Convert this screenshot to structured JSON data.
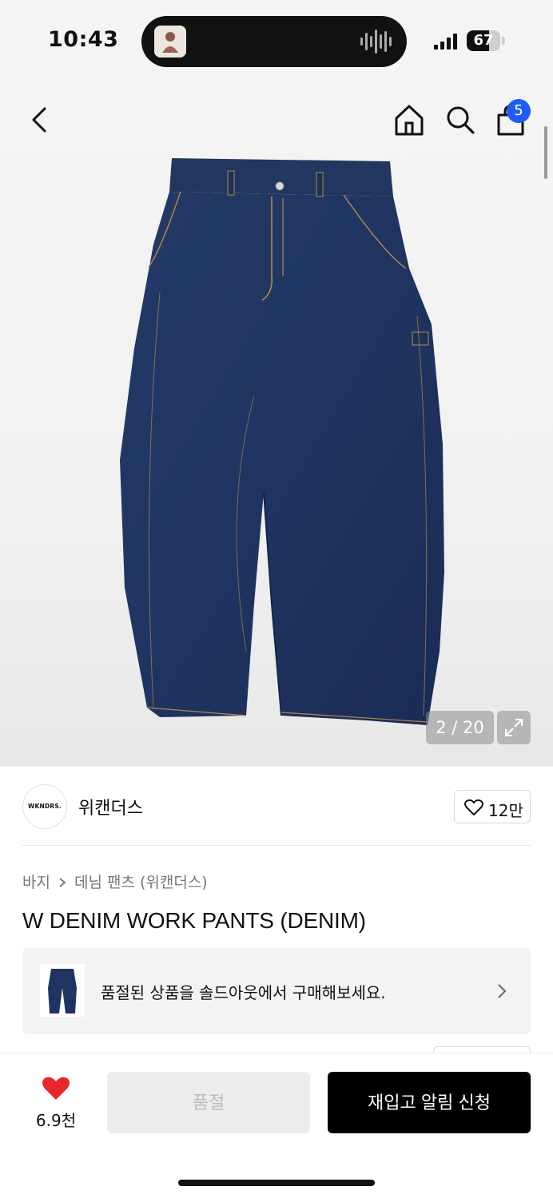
{
  "status_bar": {
    "time": "10:43",
    "battery_level": 67,
    "battery_text": "67"
  },
  "nav": {
    "back_icon": "chevron-left-icon",
    "home_icon": "home-icon",
    "search_icon": "search-icon",
    "cart_icon": "shopping-bag-icon",
    "cart_badge": "5",
    "badge_color": "#1f5cf5"
  },
  "gallery": {
    "counter": "2 / 20",
    "expand_icon": "expand-icon"
  },
  "brand": {
    "logo_text": "WKNDRS.",
    "name": "위캔더스",
    "likes": "12만"
  },
  "breadcrumb": {
    "category": "바지",
    "subcategory": "데님 팬츠 (위캔더스)"
  },
  "product": {
    "title": "W DENIM WORK PANTS (DENIM)"
  },
  "soldout_banner": {
    "text": "품절된 상품을 솔드아웃에서 구매해보세요."
  },
  "bottom_bar": {
    "wish_count": "6.9천",
    "soldout_label": "품절",
    "restock_label": "재입고 알림 신청",
    "heart_color": "#e8262b"
  }
}
